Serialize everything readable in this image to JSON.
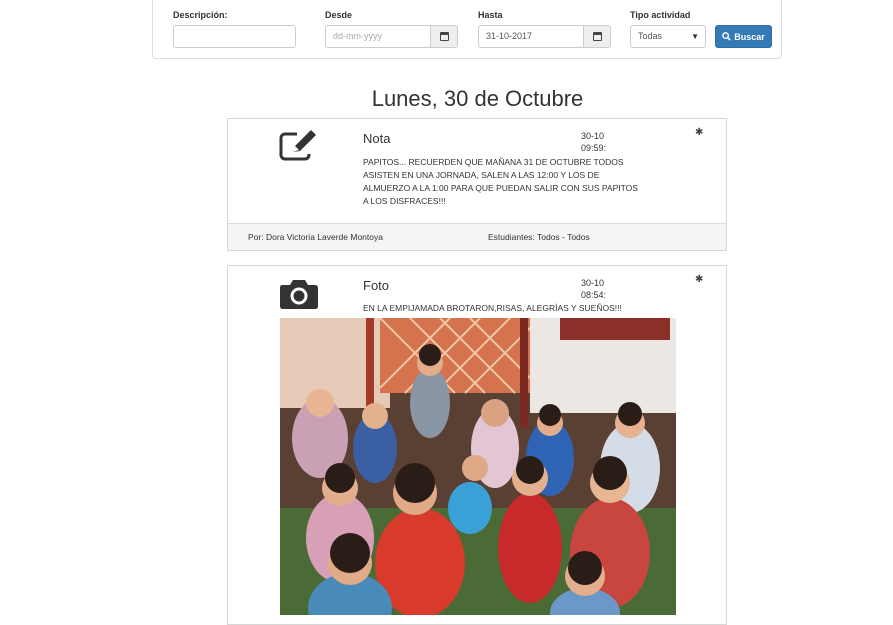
{
  "filters": {
    "descripcion_label": "Descripción:",
    "descripcion_value": "",
    "desde_label": "Desde",
    "desde_placeholder": "dd-mm-yyyy",
    "hasta_label": "Hasta",
    "hasta_value": "31-10-2017",
    "tipo_label": "Tipo actividad",
    "tipo_value": "Todas",
    "buscar_label": "Buscar"
  },
  "day_title": "Lunes, 30 de Octubre",
  "activities": [
    {
      "type": "Nota",
      "icon": "pencil-square-icon",
      "time_line1": "30-10",
      "time_line2": "09:59:",
      "body": "PAPITOS... RECUERDEN QUE MAÑANA 31 DE OCTUBRE TODOS ASISTEN EN UNA JORNADA, SALEN A LAS 12:00 Y LOS DE ALMUERZO A LA 1:00 PARA QUE PUEDAN SALIR CON SUS PAPITOS A LOS DISFRACES!!!",
      "by": "Por: Dora Victoria Laverde Montoya",
      "students": "Estudiantes: Todos - Todos"
    },
    {
      "type": "Foto",
      "icon": "camera-icon",
      "time_line1": "30-10",
      "time_line2": "08:54:",
      "body": "EN LA EMPIJAMADA BROTARON,RISAS, ALEGRÍAS Y SUEÑOS!!!"
    }
  ],
  "colors": {
    "primary_button": "#337ab7",
    "footer_bg": "#f5f5f5",
    "border": "#d8d8d8"
  }
}
